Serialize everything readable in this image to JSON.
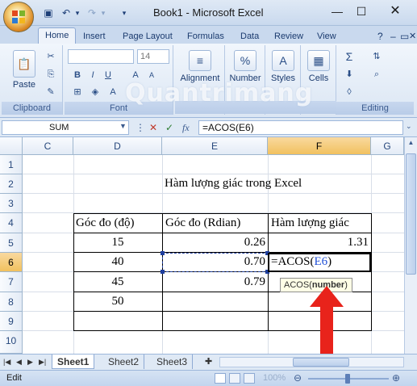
{
  "window": {
    "title": "Book1 - Microsoft Excel"
  },
  "ribbon_tabs": [
    "Home",
    "Insert",
    "Page Layout",
    "Formulas",
    "Data",
    "Review",
    "View"
  ],
  "ribbon": {
    "clipboard": {
      "label": "Clipboard",
      "paste": "Paste"
    },
    "font": {
      "label": "Font",
      "size": "14"
    },
    "alignment": "Alignment",
    "number": "Number",
    "styles": "Styles",
    "cells": "Cells",
    "editing": "Editing"
  },
  "formula_bar": {
    "name_box": "SUM",
    "fx": "fx",
    "formula": "=ACOS(E6)"
  },
  "columns": [
    "C",
    "D",
    "E",
    "F",
    "G"
  ],
  "rows": [
    "1",
    "2",
    "3",
    "4",
    "5",
    "6",
    "7",
    "8",
    "9",
    "10"
  ],
  "cells": {
    "title": "Hàm lượng giác trong Excel",
    "h_deg": "Góc đo (độ)",
    "h_rad": "Góc đo (Rdian)",
    "h_fn": "Hàm lượng giác",
    "d5": "15",
    "e5": "0.26",
    "f5": "1.31",
    "d6": "40",
    "e6": "0.70",
    "f6_prefix": "=ACOS(",
    "f6_ref": "E6",
    "f6_suffix": ")",
    "d7": "45",
    "e7": "0.79",
    "d8": "50"
  },
  "tooltip": {
    "func": "ACOS(",
    "arg": "number",
    "close": ")"
  },
  "sheet_tabs": [
    "Sheet1",
    "Sheet2",
    "Sheet3"
  ],
  "status": {
    "mode": "Edit",
    "zoom": "100%"
  },
  "watermark": "Quantrimang",
  "colors": {
    "accent_red": "#e8231b",
    "ref_blue": "#1f4fd6",
    "selection": "#1f3f9f"
  }
}
